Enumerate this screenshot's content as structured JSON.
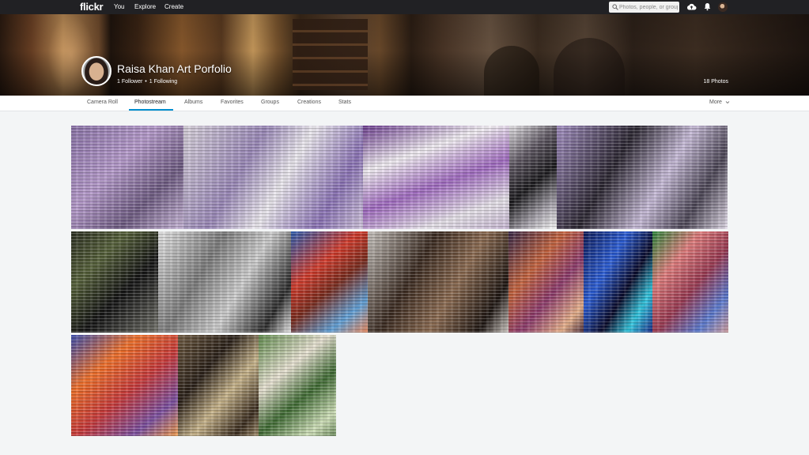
{
  "topnav": {
    "logo": "flickr",
    "links": [
      "You",
      "Explore",
      "Create"
    ],
    "search_placeholder": "Photos, people, or groups",
    "icons": [
      "search-icon",
      "upload-cloud-icon",
      "notifications-bell-icon",
      "user-avatar"
    ]
  },
  "profile": {
    "name": "Raisa Khan Art Porfolio",
    "followers": "1 Follower",
    "following": "1 Following",
    "separator": "•",
    "photo_count": "18 Photos"
  },
  "subnav": {
    "tabs": [
      "Camera Roll",
      "Photostream",
      "Albums",
      "Favorites",
      "Groups",
      "Creations",
      "Stats"
    ],
    "active_tab": "Photostream",
    "more": "More",
    "more_icon": "chevron-down-icon"
  },
  "colors": {
    "topnav_bg": "#212124",
    "accent": "#008ecf",
    "page_bg": "#f3f5f6"
  }
}
